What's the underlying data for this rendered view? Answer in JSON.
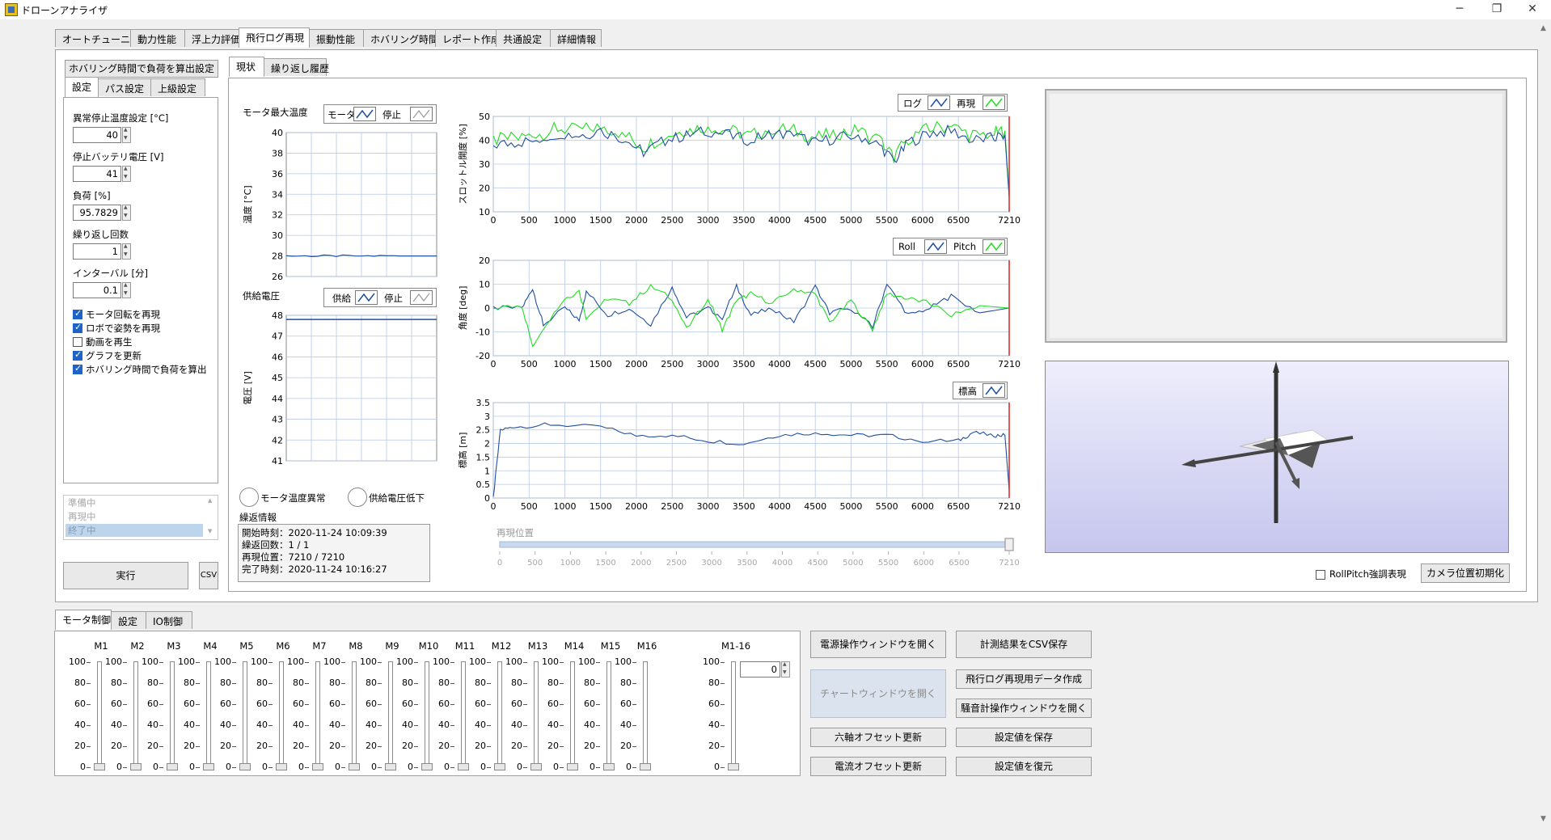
{
  "window": {
    "title": "ドローンアナライザ",
    "minimize": "─",
    "restore": "❐",
    "close": "✕"
  },
  "main_tabs": [
    "オートチューニング",
    "動力性能",
    "浮上力評価",
    "飛行ログ再現",
    "振動性能",
    "ホバリング時間",
    "レポート作成",
    "共通設定",
    "詳細情報"
  ],
  "left": {
    "header": "ホバリング時間で負荷を算出設定",
    "tabs": [
      "設定",
      "パス設定",
      "上級設定"
    ],
    "fields": [
      {
        "label": "異常停止温度設定 [°C]",
        "value": "40"
      },
      {
        "label": "停止バッテリ電圧 [V]",
        "value": "41"
      },
      {
        "label": "負荷 [%]",
        "value": "95.7829"
      },
      {
        "label": "繰り返し回数",
        "value": "1"
      },
      {
        "label": "インターバル [分]",
        "value": "0.1"
      }
    ],
    "checks": [
      {
        "label": "モータ回転を再現",
        "checked": true
      },
      {
        "label": "ロボで姿勢を再現",
        "checked": true
      },
      {
        "label": "動画を再生",
        "checked": false
      },
      {
        "label": "グラフを更新",
        "checked": true
      },
      {
        "label": "ホバリング時間で負荷を算出",
        "checked": true
      }
    ],
    "status": [
      "準備中",
      "再現中",
      "終了中"
    ],
    "run_button": "実行",
    "csv_button": "CSV"
  },
  "sub_tabs": [
    "現状",
    "繰り返し履歴"
  ],
  "temp_chart": {
    "title": "モータ最大温度",
    "legend": [
      "モータ",
      "停止"
    ],
    "ylabel": "温度 [°C]",
    "ticks": [
      "40",
      "38",
      "36",
      "34",
      "32",
      "30",
      "28",
      "26"
    ]
  },
  "volt_chart": {
    "title": "供給電圧",
    "legend": [
      "供給",
      "停止"
    ],
    "ylabel": "電圧 [V]",
    "ticks": [
      "48",
      "47",
      "46",
      "45",
      "44",
      "43",
      "42",
      "41"
    ]
  },
  "alarms": [
    "モータ温度異常",
    "供給電圧低下"
  ],
  "repeat_info": {
    "title": "繰返情報",
    "lines": [
      "開始時刻：2020-11-24 10:09:39",
      "繰返回数：1 / 1",
      "再現位置：7210 / 7210",
      "完了時刻：2020-11-24 10:16:27"
    ]
  },
  "x_ticks": [
    "0",
    "500",
    "1000",
    "1500",
    "2000",
    "2500",
    "3000",
    "3500",
    "4000",
    "4500",
    "5000",
    "5500",
    "6000",
    "6500",
    "7210"
  ],
  "throttle_chart": {
    "legend": [
      "ログ",
      "再現"
    ],
    "ylabel": "スロットル開度 [%]",
    "ticks": [
      "50",
      "40",
      "30",
      "20",
      "10"
    ]
  },
  "angle_chart": {
    "legend": [
      "Roll",
      "Pitch"
    ],
    "ylabel": "角度 [deg]",
    "ticks": [
      "20",
      "10",
      "0",
      "-10",
      "-20"
    ]
  },
  "alt_chart": {
    "legend": [
      "標高"
    ],
    "ylabel": "標高 [m]",
    "ticks": [
      "3.5",
      "3",
      "2.5",
      "2",
      "1.5",
      "1",
      "0.5",
      "0"
    ]
  },
  "playback": {
    "label": "再現位置",
    "value": 7210,
    "max": 7210
  },
  "rollpitch_label": "RollPitch強調表現",
  "camera_reset": "カメラ位置初期化",
  "bottom_tabs": [
    "モータ制御",
    "設定",
    "IO制御"
  ],
  "motors": [
    "M1",
    "M2",
    "M3",
    "M4",
    "M5",
    "M6",
    "M7",
    "M8",
    "M9",
    "M10",
    "M11",
    "M12",
    "M13",
    "M14",
    "M15",
    "M16"
  ],
  "motor_all": "M1-16",
  "motor_ticks": [
    "100",
    "80",
    "60",
    "40",
    "20",
    "0"
  ],
  "motor_all_value": "0",
  "buttons": {
    "power_window": "電源操作ウィンドウを開く",
    "save_csv": "計測結果をCSV保存",
    "chart_window": "チャートウィンドウを開く",
    "flight_log_data": "飛行ログ再現用データ作成",
    "noise_window": "騒音計操作ウィンドウを開く",
    "six_axis": "六軸オフセット更新",
    "save_settings": "設定値を保存",
    "current_offset": "電流オフセット更新",
    "restore_settings": "設定値を復元"
  },
  "colors": {
    "log": "#1f4fa0",
    "replay": "#22dd22",
    "cursor": "#e02020",
    "grid": "#b8c8e8"
  },
  "chart_data": [
    {
      "type": "line",
      "ylabel": "温度 [°C]",
      "ylim": [
        26,
        40
      ],
      "series": [
        {
          "name": "モータ",
          "values": [
            28,
            28,
            28,
            28,
            28
          ]
        }
      ]
    },
    {
      "type": "line",
      "ylabel": "電圧 [V]",
      "ylim": [
        41,
        48
      ],
      "series": [
        {
          "name": "供給",
          "values": [
            47.8,
            47.8,
            47.8,
            47.8,
            47.8
          ]
        }
      ]
    },
    {
      "type": "line",
      "ylabel": "スロットル開度 [%]",
      "xlim": [
        0,
        7210
      ],
      "ylim": [
        10,
        50
      ],
      "x": [
        0,
        300,
        600,
        900,
        1200,
        1500,
        1800,
        2100,
        2400,
        2700,
        3000,
        3300,
        3600,
        3900,
        4200,
        4500,
        4800,
        5100,
        5400,
        5600,
        5800,
        6100,
        6400,
        6700,
        7000,
        7150,
        7210
      ],
      "series": [
        {
          "name": "ログ",
          "values": [
            40,
            41,
            42,
            45,
            44,
            46,
            43,
            37,
            42,
            44,
            46,
            44,
            42,
            45,
            44,
            41,
            43,
            44,
            40,
            33,
            41,
            45,
            46,
            42,
            43,
            44,
            17
          ]
        },
        {
          "name": "再現",
          "values": [
            38,
            39,
            40,
            43,
            42,
            44,
            41,
            35,
            40,
            42,
            44,
            42,
            40,
            43,
            42,
            39,
            41,
            42,
            38,
            31,
            39,
            43,
            44,
            40,
            41,
            42,
            16
          ]
        }
      ]
    },
    {
      "type": "line",
      "ylabel": "角度 [deg]",
      "xlim": [
        0,
        7210
      ],
      "ylim": [
        -20,
        20
      ],
      "x": [
        0,
        400,
        550,
        700,
        1000,
        1200,
        1300,
        1600,
        1900,
        2200,
        2500,
        2700,
        3000,
        3200,
        3400,
        3600,
        3900,
        4200,
        4500,
        4700,
        5000,
        5300,
        5500,
        5800,
        6100,
        6400,
        6800,
        7210
      ],
      "series": [
        {
          "name": "Roll",
          "values": [
            0,
            0,
            8,
            -7,
            0,
            -5,
            7,
            -3,
            0,
            -7,
            9,
            -4,
            0,
            -4,
            9,
            -3,
            0,
            -6,
            9,
            -2,
            0,
            -8,
            10,
            -3,
            0,
            5,
            -2,
            0
          ]
        },
        {
          "name": "Pitch",
          "values": [
            0,
            1,
            -16,
            -8,
            4,
            7,
            -4,
            4,
            2,
            9,
            4,
            -9,
            4,
            -9,
            3,
            6,
            2,
            8,
            6,
            -6,
            3,
            -9,
            6,
            4,
            2,
            -3,
            1,
            0
          ]
        }
      ]
    },
    {
      "type": "line",
      "ylabel": "標高 [m]",
      "xlim": [
        0,
        7210
      ],
      "ylim": [
        0,
        3.5
      ],
      "x": [
        0,
        100,
        300,
        800,
        1500,
        2000,
        2500,
        3000,
        3500,
        4000,
        4500,
        5000,
        5500,
        6000,
        6500,
        6700,
        7000,
        7150,
        7210
      ],
      "series": [
        {
          "name": "標高",
          "values": [
            0,
            2.5,
            2.6,
            2.7,
            2.6,
            2.3,
            2.3,
            2.1,
            2.0,
            2.3,
            2.4,
            2.3,
            2.3,
            2.1,
            2.1,
            2.4,
            2.3,
            2.3,
            0.3
          ]
        }
      ]
    }
  ]
}
